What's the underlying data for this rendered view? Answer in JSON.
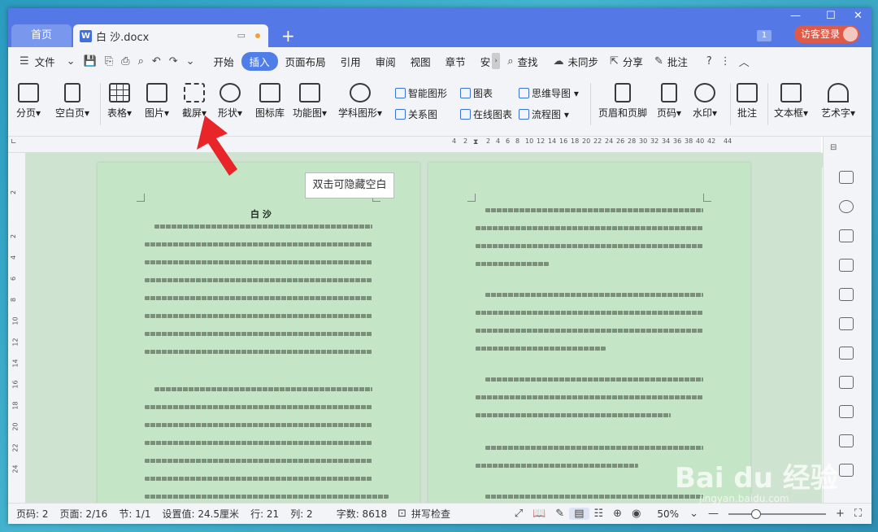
{
  "titlebar": {
    "home_tab": "首页",
    "doc_tab": "白 沙.docx",
    "doc_icon": "W",
    "new_tab": "+",
    "badge": "1",
    "visitor_login": "访客登录"
  },
  "menubar": {
    "file_menu": "文件",
    "tabs": [
      "开始",
      "插入",
      "页面布局",
      "引用",
      "审阅",
      "视图",
      "章节",
      "安"
    ],
    "active_tab": "插入",
    "search": "查找",
    "sync": "未同步",
    "share": "分享",
    "comment": "批注"
  },
  "ribbon": {
    "page_break": "分页",
    "blank_page": "空白页",
    "table": "表格",
    "picture": "图片",
    "screenshot": "截屏",
    "shapes": "形状",
    "icon_lib": "图标库",
    "func_chart": "功能图",
    "subject_chart": "学科图形",
    "smart_shape": "智能图形",
    "chart": "图表",
    "mindmap": "思维导图",
    "relation": "关系图",
    "online_chart": "在线图表",
    "flowchart": "流程图",
    "header_footer": "页眉和页脚",
    "page_number": "页码",
    "watermark": "水印",
    "comment": "批注",
    "textbox": "文本框",
    "wordart": "艺术字"
  },
  "ruler": {
    "numbers": [
      "4",
      "2",
      "2",
      "4",
      "6",
      "8",
      "10",
      "12",
      "14",
      "16",
      "18",
      "20",
      "22",
      "24",
      "26",
      "28",
      "30",
      "32",
      "34",
      "36",
      "38",
      "40",
      "42",
      "44"
    ]
  },
  "vruler": {
    "numbers": [
      "2",
      "2",
      "4",
      "6",
      "8",
      "10",
      "12",
      "14",
      "16",
      "18",
      "20",
      "22",
      "24"
    ]
  },
  "document": {
    "hide_blank_tooltip": "双击可隐藏空白",
    "title": "白 沙"
  },
  "statusbar": {
    "page_num": "页码: 2",
    "pages": "页面: 2/16",
    "section": "节: 1/1",
    "setting": "设置值: 24.5厘米",
    "row": "行: 21",
    "col": "列: 2",
    "chars": "字数: 8618",
    "spell": "拼写检查",
    "zoom": "50%"
  },
  "watermark": {
    "brand": "Bai du 经验",
    "url": "jingyan.baidu.com"
  }
}
